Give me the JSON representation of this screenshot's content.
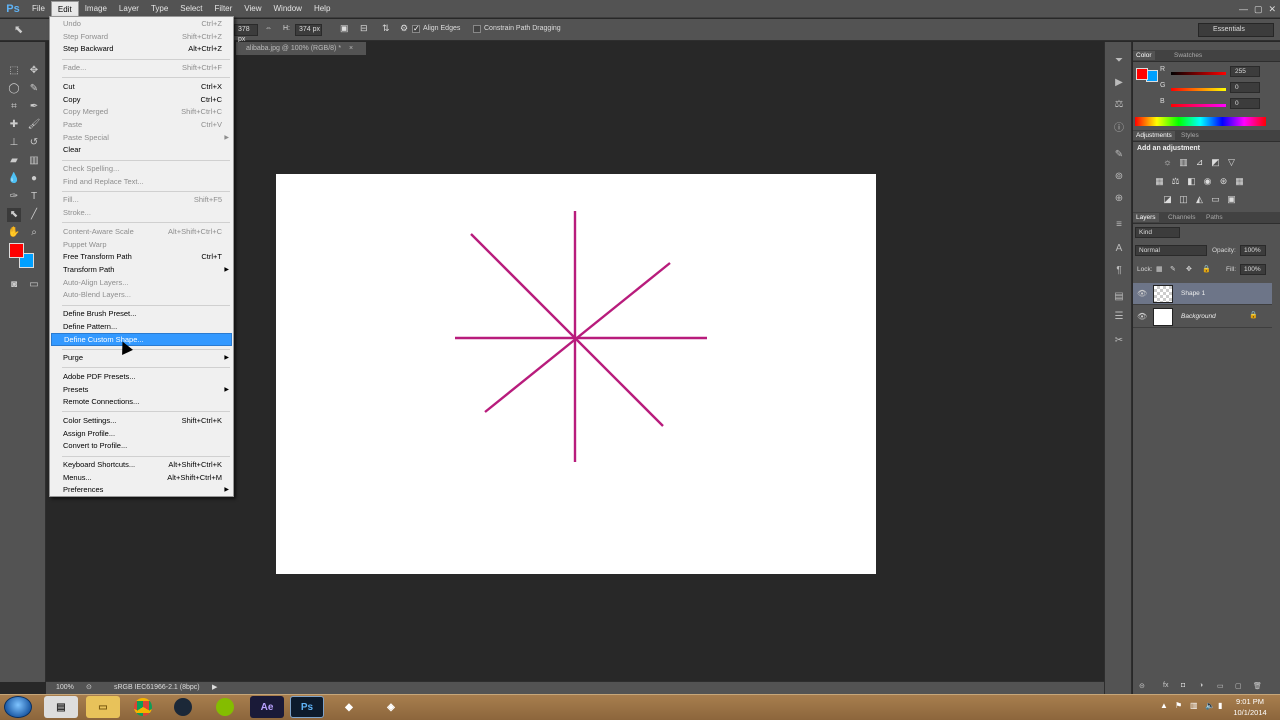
{
  "app": {
    "logo": "Ps"
  },
  "menubar": [
    "File",
    "Edit",
    "Image",
    "Layer",
    "Type",
    "Select",
    "Filter",
    "View",
    "Window",
    "Help"
  ],
  "window_controls": [
    "—",
    "▢",
    "✕"
  ],
  "options": {
    "w_value": "378 px",
    "h_label": "H:",
    "h_value": "374 px",
    "align_edges": "Align Edges",
    "constrain": "Constrain Path Dragging",
    "workspace": "Essentials"
  },
  "document": {
    "tab": "alibaba.jpg @ 100% (RGB/8) *",
    "zoom": "100%",
    "profile": "sRGB IEC61966-2.1 (8bpc)"
  },
  "edit_menu": [
    {
      "label": "Undo",
      "shortcut": "Ctrl+Z",
      "disabled": true
    },
    {
      "label": "Step Forward",
      "shortcut": "Shift+Ctrl+Z",
      "disabled": true
    },
    {
      "label": "Step Backward",
      "shortcut": "Alt+Ctrl+Z",
      "disabled": false
    },
    {
      "sep": true
    },
    {
      "label": "Fade...",
      "shortcut": "Shift+Ctrl+F",
      "disabled": true
    },
    {
      "sep": true
    },
    {
      "label": "Cut",
      "shortcut": "Ctrl+X",
      "disabled": false
    },
    {
      "label": "Copy",
      "shortcut": "Ctrl+C",
      "disabled": false
    },
    {
      "label": "Copy Merged",
      "shortcut": "Shift+Ctrl+C",
      "disabled": true
    },
    {
      "label": "Paste",
      "shortcut": "Ctrl+V",
      "disabled": true
    },
    {
      "label": "Paste Special",
      "shortcut": "",
      "disabled": true,
      "submenu": true
    },
    {
      "label": "Clear",
      "shortcut": "",
      "disabled": false
    },
    {
      "sep": true
    },
    {
      "label": "Check Spelling...",
      "shortcut": "",
      "disabled": true
    },
    {
      "label": "Find and Replace Text...",
      "shortcut": "",
      "disabled": true
    },
    {
      "sep": true
    },
    {
      "label": "Fill...",
      "shortcut": "Shift+F5",
      "disabled": true
    },
    {
      "label": "Stroke...",
      "shortcut": "",
      "disabled": true
    },
    {
      "sep": true
    },
    {
      "label": "Content-Aware Scale",
      "shortcut": "Alt+Shift+Ctrl+C",
      "disabled": true
    },
    {
      "label": "Puppet Warp",
      "shortcut": "",
      "disabled": true
    },
    {
      "label": "Free Transform Path",
      "shortcut": "Ctrl+T",
      "disabled": false
    },
    {
      "label": "Transform Path",
      "shortcut": "",
      "disabled": false,
      "submenu": true
    },
    {
      "label": "Auto-Align Layers...",
      "shortcut": "",
      "disabled": true
    },
    {
      "label": "Auto-Blend Layers...",
      "shortcut": "",
      "disabled": true
    },
    {
      "sep": true
    },
    {
      "label": "Define Brush Preset...",
      "shortcut": "",
      "disabled": false
    },
    {
      "label": "Define Pattern...",
      "shortcut": "",
      "disabled": false
    },
    {
      "label": "Define Custom Shape...",
      "shortcut": "",
      "disabled": false,
      "highlighted": true
    },
    {
      "sep": true
    },
    {
      "label": "Purge",
      "shortcut": "",
      "disabled": false,
      "submenu": true
    },
    {
      "sep": true
    },
    {
      "label": "Adobe PDF Presets...",
      "shortcut": "",
      "disabled": false
    },
    {
      "label": "Presets",
      "shortcut": "",
      "disabled": false,
      "submenu": true
    },
    {
      "label": "Remote Connections...",
      "shortcut": "",
      "disabled": false
    },
    {
      "sep": true
    },
    {
      "label": "Color Settings...",
      "shortcut": "Shift+Ctrl+K",
      "disabled": false
    },
    {
      "label": "Assign Profile...",
      "shortcut": "",
      "disabled": false
    },
    {
      "label": "Convert to Profile...",
      "shortcut": "",
      "disabled": false
    },
    {
      "sep": true
    },
    {
      "label": "Keyboard Shortcuts...",
      "shortcut": "Alt+Shift+Ctrl+K",
      "disabled": false
    },
    {
      "label": "Menus...",
      "shortcut": "Alt+Shift+Ctrl+M",
      "disabled": false
    },
    {
      "label": "Preferences",
      "shortcut": "",
      "disabled": false,
      "submenu": true
    }
  ],
  "color_panel": {
    "tabs": [
      "Color",
      "Swatches"
    ],
    "r_label": "R",
    "g_label": "G",
    "b_label": "B",
    "r": "255",
    "g": "0",
    "b": "0",
    "fg_color": "#ff0000",
    "bg_color": "#00a0ff"
  },
  "adjustments_panel": {
    "tabs": [
      "Adjustments",
      "Styles"
    ],
    "heading": "Add an adjustment"
  },
  "layers_panel": {
    "tabs": [
      "Layers",
      "Channels",
      "Paths"
    ],
    "kind": "Kind",
    "blend_mode": "Normal",
    "opacity_label": "Opacity:",
    "opacity": "100%",
    "lock_label": "Lock:",
    "fill_label": "Fill:",
    "fill": "100%",
    "layers": [
      {
        "name": "Shape 1",
        "selected": true
      },
      {
        "name": "Background",
        "selected": false
      }
    ]
  },
  "shape": {
    "stroke_color": "#b81c7c"
  },
  "taskbar": {
    "time": "9:01 PM",
    "date": "10/1/2014",
    "apps": [
      "explorer",
      "chrome",
      "steam",
      "spotify",
      "after-effects",
      "photoshop",
      "app",
      "app"
    ],
    "ae_label": "Ae",
    "ps_label": "Ps"
  }
}
